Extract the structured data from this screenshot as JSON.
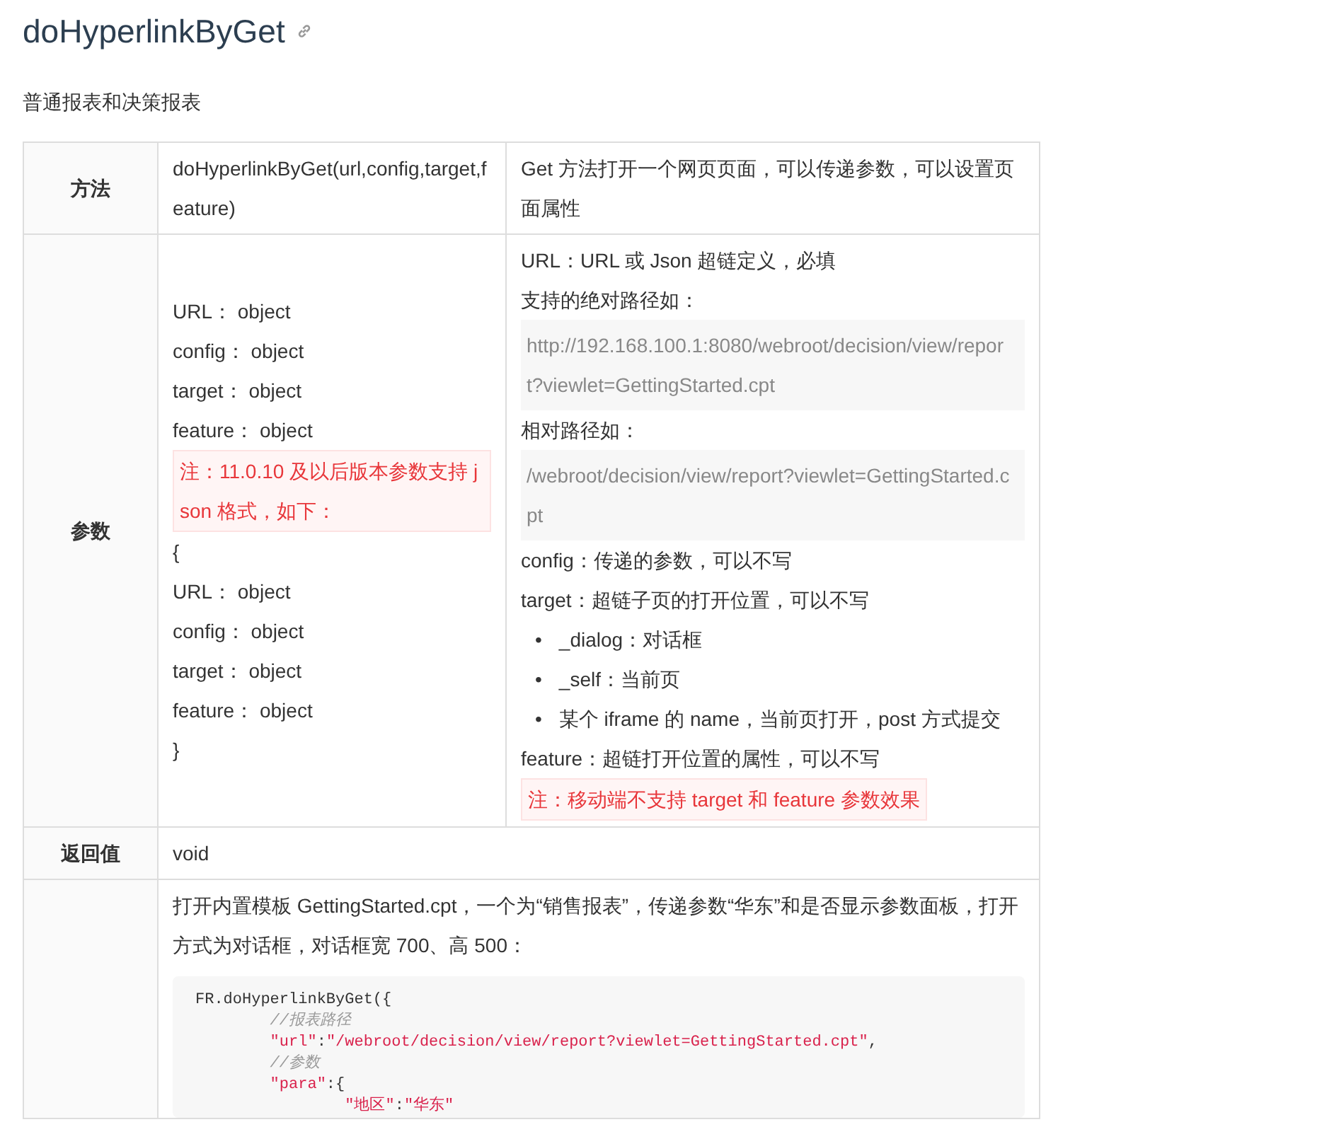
{
  "title": "doHyperlinkByGet",
  "subtitle": "普通报表和决策报表",
  "rows": [
    {
      "header": "方法",
      "cells": [
        [
          {
            "kind": "text",
            "text": "doHyperlinkByGet(url,config,target,feature)"
          }
        ],
        [
          {
            "kind": "text",
            "text": "Get 方法打开一个网页页面，可以传递参数，可以设置页面属性"
          }
        ]
      ]
    },
    {
      "header": "参数",
      "cells": [
        [
          {
            "kind": "text",
            "text": "URL： object"
          },
          {
            "kind": "text",
            "text": "config： object"
          },
          {
            "kind": "text",
            "text": "target： object"
          },
          {
            "kind": "text",
            "text": "feature： object"
          },
          {
            "kind": "note",
            "text": "注：11.0.10 及以后版本参数支持 json 格式，如下："
          },
          {
            "kind": "text",
            "text": "{"
          },
          {
            "kind": "text",
            "text": "URL： object"
          },
          {
            "kind": "text",
            "text": "config： object"
          },
          {
            "kind": "text",
            "text": "target： object"
          },
          {
            "kind": "text",
            "text": "feature： object"
          },
          {
            "kind": "text",
            "text": "}"
          }
        ],
        [
          {
            "kind": "text",
            "text": "URL：URL 或 Json 超链定义，必填"
          },
          {
            "kind": "text",
            "text": "支持的绝对路径如："
          },
          {
            "kind": "path",
            "text": "http://192.168.100.1:8080/webroot/decision/view/report?viewlet=GettingStarted.cpt"
          },
          {
            "kind": "text",
            "text": "相对路径如："
          },
          {
            "kind": "path",
            "text": "/webroot/decision/view/report?viewlet=GettingStarted.cpt"
          },
          {
            "kind": "text",
            "text": "config：传递的参数，可以不写"
          },
          {
            "kind": "text",
            "text": "target：超链子页的打开位置，可以不写"
          },
          {
            "kind": "bullets",
            "items": [
              {
                "bullet": "•",
                "text": "_dialog：对话框"
              },
              {
                "bullet": "•",
                "text": "_self：当前页"
              },
              {
                "bullet": "•",
                "text": "某个 iframe 的 name，当前页打开，post 方式提交"
              }
            ]
          },
          {
            "kind": "text",
            "text": "feature：超链打开位置的属性，可以不写"
          },
          {
            "kind": "note",
            "text": "注：移动端不支持 target 和 feature 参数效果"
          }
        ]
      ]
    },
    {
      "header": "返回值",
      "cells": [
        [
          {
            "kind": "text",
            "text": "void"
          }
        ]
      ]
    },
    {
      "cells": [
        [
          {
            "kind": "text",
            "text": "打开内置模板 GettingStarted.cpt，一个为“销售报表”，传递参数“华东”和是否显示参数面板，打开方式为对话框，对话框宽 700、高 500："
          },
          {
            "kind": "code",
            "lines": [
              [
                {
                  "kind": "plain",
                  "text": "FR.doHyperlinkByGet({"
                }
              ],
              [
                {
                  "kind": "comment",
                  "text": "        //报表路径"
                }
              ],
              [
                {
                  "kind": "string",
                  "text": "        \"url\""
                },
                {
                  "kind": "plain",
                  "text": ":"
                },
                {
                  "kind": "string",
                  "text": "\"/webroot/decision/view/report?viewlet=GettingStarted.cpt\""
                },
                {
                  "kind": "plain",
                  "text": ","
                }
              ],
              [
                {
                  "kind": "comment",
                  "text": "        //参数"
                }
              ],
              [
                {
                  "kind": "string",
                  "text": "        \"para\""
                },
                {
                  "kind": "plain",
                  "text": ":{"
                }
              ],
              [
                {
                  "kind": "string",
                  "text": "                \"地区\""
                },
                {
                  "kind": "plain",
                  "text": ":"
                },
                {
                  "kind": "string",
                  "text": "\"华东\""
                }
              ]
            ]
          }
        ]
      ]
    }
  ]
}
